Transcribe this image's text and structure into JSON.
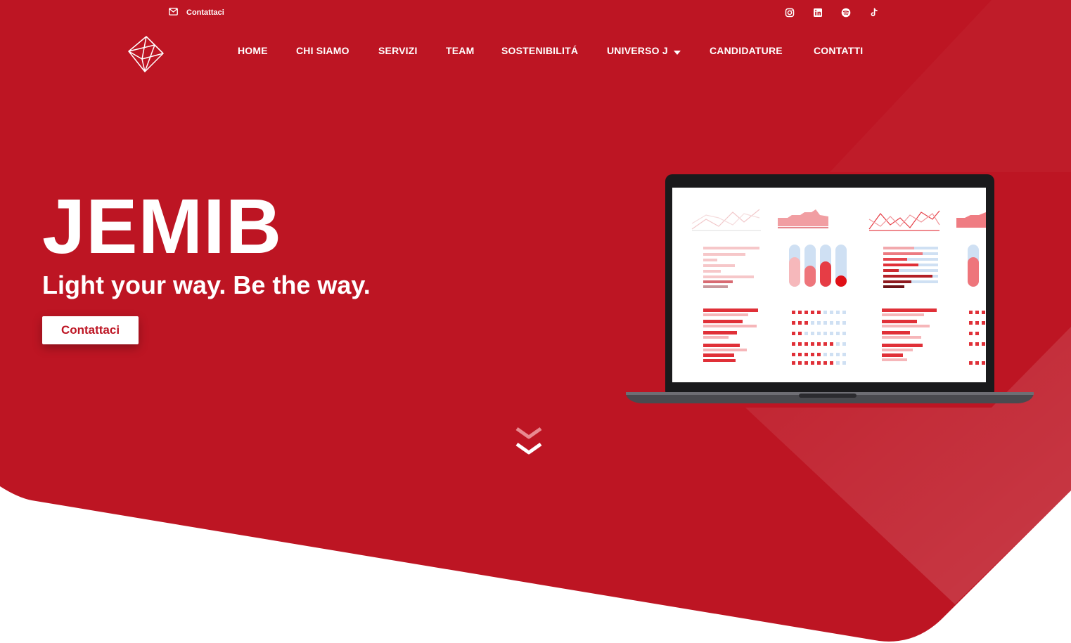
{
  "colors": {
    "brand_red": "#bd1523",
    "white": "#ffffff",
    "screen_red": "#e03038",
    "screen_blue": "#cfe0f3"
  },
  "topbar": {
    "contact": {
      "icon": "envelope-icon",
      "label": "Contattaci"
    },
    "social": [
      "instagram-icon",
      "linkedin-icon",
      "spotify-icon",
      "tiktok-icon"
    ]
  },
  "nav": {
    "logo": "geometric-logo",
    "items": [
      {
        "label": "HOME"
      },
      {
        "label": "CHI SIAMO"
      },
      {
        "label": "SERVIZI"
      },
      {
        "label": "TEAM"
      },
      {
        "label": "SOSTENIBILITÁ"
      },
      {
        "label": "UNIVERSO J",
        "icon": "caret-down-icon"
      },
      {
        "label": "CANDIDATURE"
      },
      {
        "label": "CONTATTI"
      }
    ]
  },
  "hero": {
    "title": "JEMIB",
    "tagline": "Light your way. Be the way.",
    "cta_label": "Contattaci",
    "scroll_icon": "double-chevron-down-icon",
    "laptop_image": "dashboard-laptop-illustration"
  }
}
